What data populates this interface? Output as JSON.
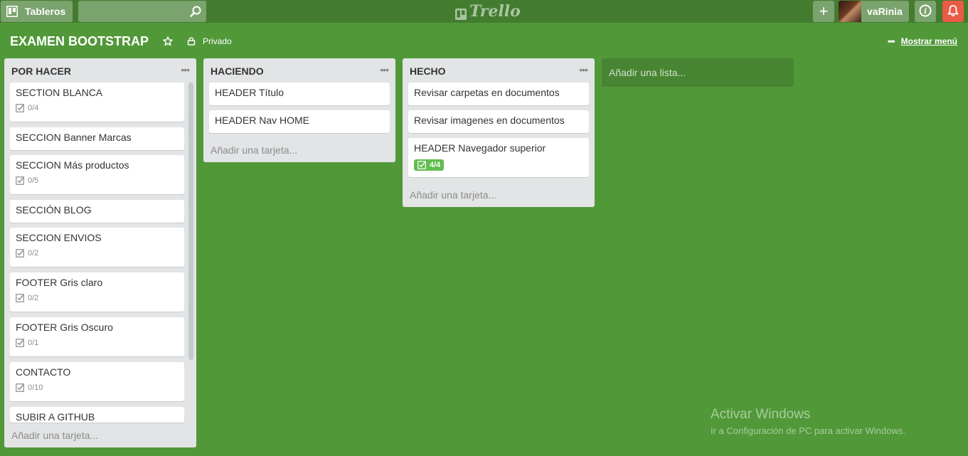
{
  "header": {
    "boards_label": "Tableros",
    "search_value": "",
    "logo_text": "Trello",
    "user_name": "vaRinia",
    "add_symbol": "+",
    "info_symbol": "i"
  },
  "board": {
    "title": "EXAMEN BOOTSTRAP",
    "visibility": "Privado",
    "menu_label": "Mostrar menú"
  },
  "lists": [
    {
      "title": "POR HACER",
      "cards": [
        {
          "title": "SECTION BLANCA",
          "checklist": "0/4"
        },
        {
          "title": "SECCION Banner Marcas",
          "checklist": ""
        },
        {
          "title": "SECCION Más productos",
          "checklist": "0/5"
        },
        {
          "title": "SECCIÓN BLOG",
          "checklist": ""
        },
        {
          "title": "SECCION ENVIOS",
          "checklist": "0/2"
        },
        {
          "title": "FOOTER Gris claro",
          "checklist": "0/2"
        },
        {
          "title": "FOOTER Gris Oscuro",
          "checklist": "0/1"
        },
        {
          "title": "CONTACTO",
          "checklist": "0/10"
        },
        {
          "title": "SUBIR A GITHUB",
          "checklist": ""
        }
      ],
      "add_card_label": "Añadir una tarjeta..."
    },
    {
      "title": "HACIENDO",
      "cards": [
        {
          "title": "HEADER Título",
          "checklist": ""
        },
        {
          "title": "HEADER Nav HOME",
          "checklist": ""
        }
      ],
      "add_card_label": "Añadir una tarjeta..."
    },
    {
      "title": "HECHO",
      "cards": [
        {
          "title": "Revisar carpetas en documentos",
          "checklist": ""
        },
        {
          "title": "Revisar imagenes en documentos",
          "checklist": ""
        },
        {
          "title": "HEADER Navegador superior",
          "checklist": "4/4"
        }
      ],
      "add_card_label": "Añadir una tarjeta..."
    }
  ],
  "add_list_label": "Añadir una lista...",
  "watermark": {
    "line1": "Activar Windows",
    "line2": "Ir a Configuración de PC para activar Windows."
  },
  "colors": {
    "board_bg": "#519839",
    "header_bg": "#437c2f",
    "list_bg": "#e2e4e6",
    "badge_done": "#61bd4f",
    "notification": "#eb5a46"
  },
  "icons": [
    "boards-icon",
    "search-icon",
    "trello-logo-icon",
    "plus-icon",
    "info-icon",
    "bell-icon",
    "star-icon",
    "lock-icon",
    "ellipsis-icon",
    "checklist-icon"
  ]
}
